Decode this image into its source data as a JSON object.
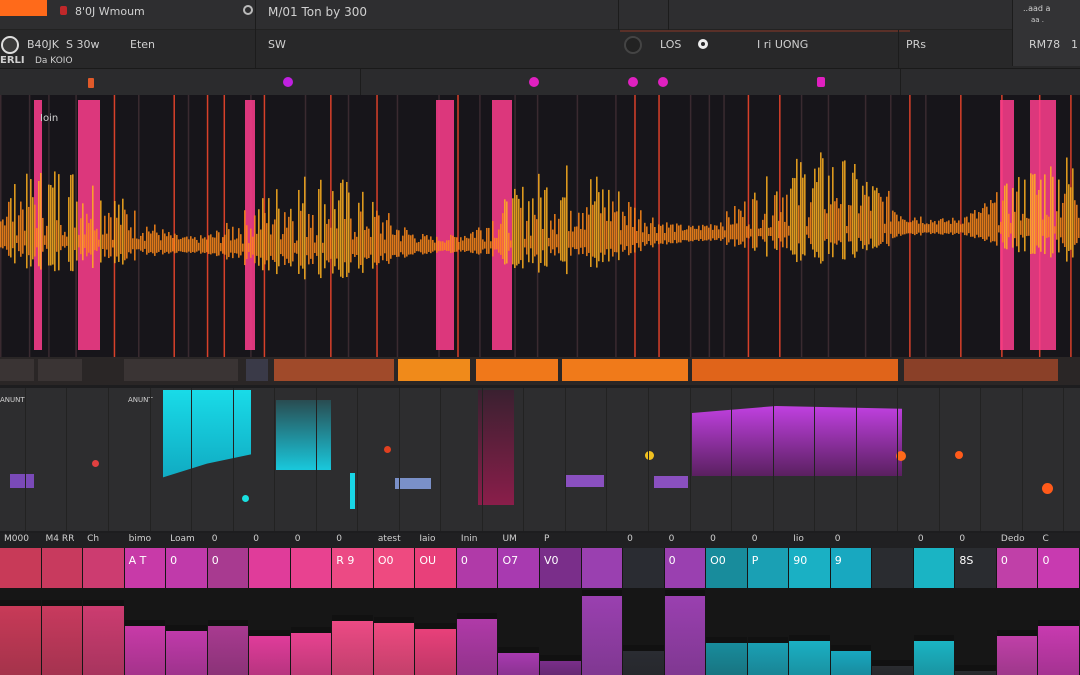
{
  "titlebar": {
    "title": "8'0J Wmoum",
    "center": "M/01 Ton by 300",
    "right_top": "..aad a",
    "right_sub": "aa ."
  },
  "header": {
    "f1": "B40JK",
    "f2": "S 30w",
    "f3": "Eten",
    "f4": "SW",
    "f5": "LOS",
    "f6": "I ri UONG",
    "f7": "PRs",
    "f8": "RM78",
    "f9": "1",
    "left_label": "ERLI",
    "left_sub": "Da KOIO"
  },
  "waveform": {
    "label": "Ioin",
    "accent": "#ff8a1a",
    "highlight": "#ff3d8e"
  },
  "mixer": {
    "label1": "ANUNT",
    "label2": "ANUNT",
    "cyan": "#19d6e6",
    "magenta": "#c040e0"
  },
  "channels": [
    {
      "label": "M000",
      "color": "#c83a58"
    },
    {
      "label": "M4 RR",
      "color": "#c83a5e"
    },
    {
      "label": "Ch",
      "color": "#cc3c70"
    },
    {
      "label": "bimo",
      "color": "#c83aa8"
    },
    {
      "label": "Loam",
      "color": "#c03aaa"
    },
    {
      "label": "0",
      "color": "#a83a90"
    },
    {
      "label": "0",
      "color": "#e03c9a"
    },
    {
      "label": "0",
      "color": "#e84290"
    },
    {
      "label": "0",
      "color": "#ec4a84"
    },
    {
      "label": "atest",
      "color": "#ee4a80"
    },
    {
      "label": "Iaio",
      "color": "#e8407a"
    },
    {
      "label": "Inin",
      "color": "#b03aa8"
    },
    {
      "label": "UM",
      "color": "#a83ab0"
    },
    {
      "label": "P",
      "color": "#7a2e8a"
    },
    {
      "label": "",
      "color": "#9a40b0"
    },
    {
      "label": "0",
      "color": "#2a2c32"
    },
    {
      "label": "0",
      "color": "#9a40b0"
    },
    {
      "label": "0",
      "color": "#188c9c"
    },
    {
      "label": "0",
      "color": "#1aa0b4"
    },
    {
      "label": "Iio",
      "color": "#1ab0c4"
    },
    {
      "label": "0",
      "color": "#18a8c0"
    },
    {
      "label": "",
      "color": "#2a2c30"
    },
    {
      "label": "0",
      "color": "#1ab4c4"
    },
    {
      "label": "0",
      "color": "#2a2c30"
    },
    {
      "label": "Dedo",
      "color": "#c040a8"
    },
    {
      "label": "C",
      "color": "#c83ab0"
    }
  ],
  "tile_texts": [
    "",
    "",
    "",
    "A T",
    "0",
    "0",
    "",
    "",
    "R 9",
    "O0",
    "OU",
    "0",
    "O7",
    "V0",
    "",
    "",
    "0",
    "O0",
    "P",
    "90",
    "9",
    "",
    "",
    "8S",
    "0",
    "0"
  ]
}
